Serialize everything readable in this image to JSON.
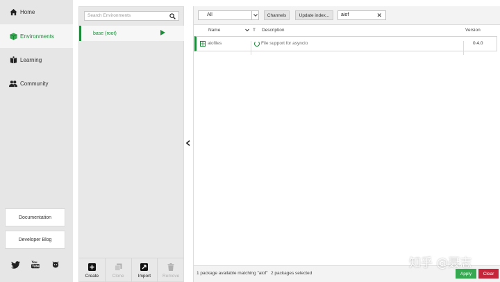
{
  "nav": {
    "items": [
      {
        "label": "Home",
        "icon": "home-icon"
      },
      {
        "label": "Environments",
        "icon": "cube-icon"
      },
      {
        "label": "Learning",
        "icon": "book-icon"
      },
      {
        "label": "Community",
        "icon": "people-icon"
      }
    ],
    "documentation_label": "Documentation",
    "blog_label": "Developer Blog",
    "social": [
      "twitter-icon",
      "youtube-icon",
      "github-icon"
    ]
  },
  "environments": {
    "search_placeholder": "Search Environments",
    "items": [
      {
        "name": "base (root)"
      }
    ],
    "actions": {
      "create": "Create",
      "clone": "Clone",
      "import": "Import",
      "remove": "Remove"
    }
  },
  "packages": {
    "filter_value": "All",
    "channels_label": "Channels",
    "update_label": "Update index...",
    "search_value": "aiof",
    "columns": {
      "name": "Name",
      "type": "T",
      "description": "Description",
      "version": "Version"
    },
    "rows": [
      {
        "name": "aiofiles",
        "description": "File support for asyncio",
        "version": "0.4.0"
      }
    ],
    "status_text": "1 package available matching \"aiof\"",
    "selected_text": "2 packages selected",
    "apply_label": "Apply",
    "clear_label": "Clear"
  },
  "watermark": "知乎 @聂志",
  "colors": {
    "accent": "#1d8a3a",
    "apply": "#36a852",
    "clear": "#c6263a"
  }
}
